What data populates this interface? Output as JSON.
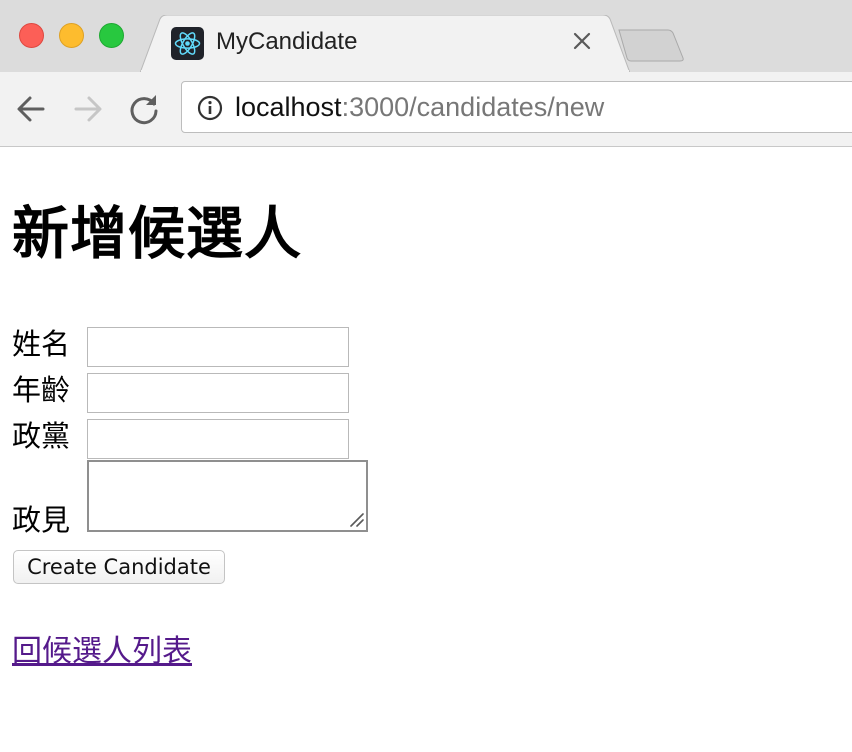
{
  "browser": {
    "tab": {
      "title": "MyCandidate",
      "favicon": "react-logo-icon"
    },
    "address_bar": {
      "host": "localhost",
      "path": ":3000/candidates/new"
    },
    "colors": {
      "tab_strip": "#dcdcdc",
      "toolbar": "#f2f2f2",
      "close": "#fc5f57",
      "minimize": "#fdbc2e",
      "maximize": "#28c83f"
    }
  },
  "page": {
    "title": "新增候選人",
    "form": {
      "fields": [
        {
          "label": "姓名",
          "type": "text",
          "value": ""
        },
        {
          "label": "年齡",
          "type": "text",
          "value": ""
        },
        {
          "label": "政黨",
          "type": "text",
          "value": ""
        },
        {
          "label": "政見",
          "type": "textarea",
          "value": ""
        }
      ],
      "submit_label": "Create Candidate"
    },
    "back_link": "回候選人列表",
    "colors": {
      "visited_link": "#551a8b"
    }
  }
}
